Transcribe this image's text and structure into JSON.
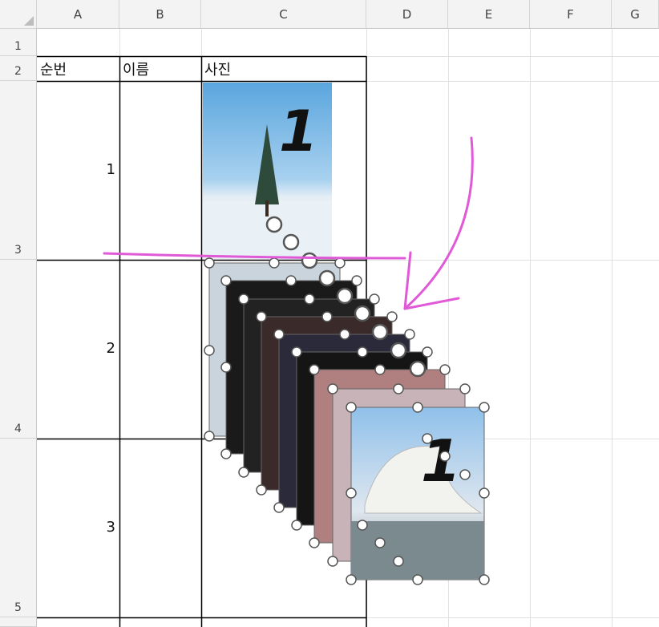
{
  "columns": [
    "A",
    "B",
    "C",
    "D",
    "E",
    "F",
    "G"
  ],
  "rows": [
    "1",
    "2",
    "3",
    "4",
    "5"
  ],
  "header": {
    "col_a": "순번",
    "col_b": "이름",
    "col_c": "사진"
  },
  "data_rows": [
    {
      "seq": "1",
      "name": "",
      "photo": "tree-snow-image"
    },
    {
      "seq": "2",
      "name": "",
      "photo": "stacked-images"
    },
    {
      "seq": "3",
      "name": "",
      "photo": ""
    }
  ],
  "photo_overlay_text": "1",
  "annotation": {
    "color": "#e05ad8",
    "description_icon": "arrow-annotation"
  },
  "colors": {
    "grid": "#e1e1e1",
    "border": "#000000",
    "header_bg": "#f3f3f3",
    "handle": "#ffffff"
  }
}
